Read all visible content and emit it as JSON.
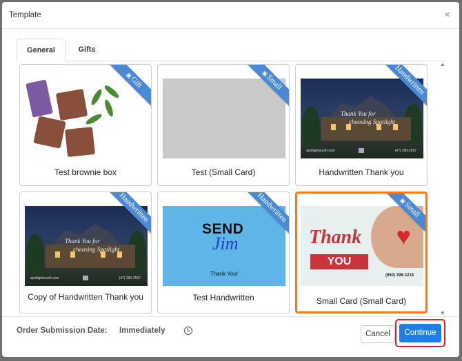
{
  "modal": {
    "title": "Template",
    "close_symbol": "×"
  },
  "tabs": [
    {
      "label": "General",
      "active": true
    },
    {
      "label": "Gifts",
      "active": false
    }
  ],
  "cards": [
    {
      "name": "Test brownie box",
      "badge": "Gift",
      "badge_icon": "gift-icon",
      "selected": false
    },
    {
      "name": "Test (Small Card)",
      "badge": "Small",
      "badge_icon": "card-icon",
      "selected": false
    },
    {
      "name": "Handwritten Thank you",
      "badge": "Handwritten",
      "selected": false,
      "thumb_text": {
        "line1": "Thank You for",
        "line2": "choosing Spotlight",
        "footer_left": "spotlightsouth.com",
        "footer_right": "(47) 290-2597"
      }
    },
    {
      "name": "Copy of Handwritten Thank you",
      "badge": "Handwritten",
      "selected": false,
      "thumb_text": {
        "line1": "Thank You for",
        "line2": "choosing Spotlight",
        "footer_left": "spotlightsouth.com",
        "footer_right": "(47) 290-2597"
      }
    },
    {
      "name": "Test Handwritten",
      "badge": "Handwritten",
      "selected": false,
      "thumb_text": {
        "send": "SEND",
        "jim": "Jim",
        "thank_you": "Thank You!"
      }
    },
    {
      "name": "Small Card (Small Card)",
      "badge": "Small",
      "badge_icon": "card-icon",
      "selected": true,
      "thumb_text": {
        "thank": "Thank",
        "you": "YOU",
        "phone": "(850) 398-3218"
      }
    }
  ],
  "footer": {
    "order_submission_label": "Order Submission Date:",
    "order_submission_value": "Immediately",
    "cancel_label": "Cancel",
    "continue_label": "Continue"
  },
  "colors": {
    "accent": "#1e7ee6",
    "selected_border": "#f37a20",
    "ribbon": "#4a8ad4",
    "highlight": "#e02121"
  }
}
